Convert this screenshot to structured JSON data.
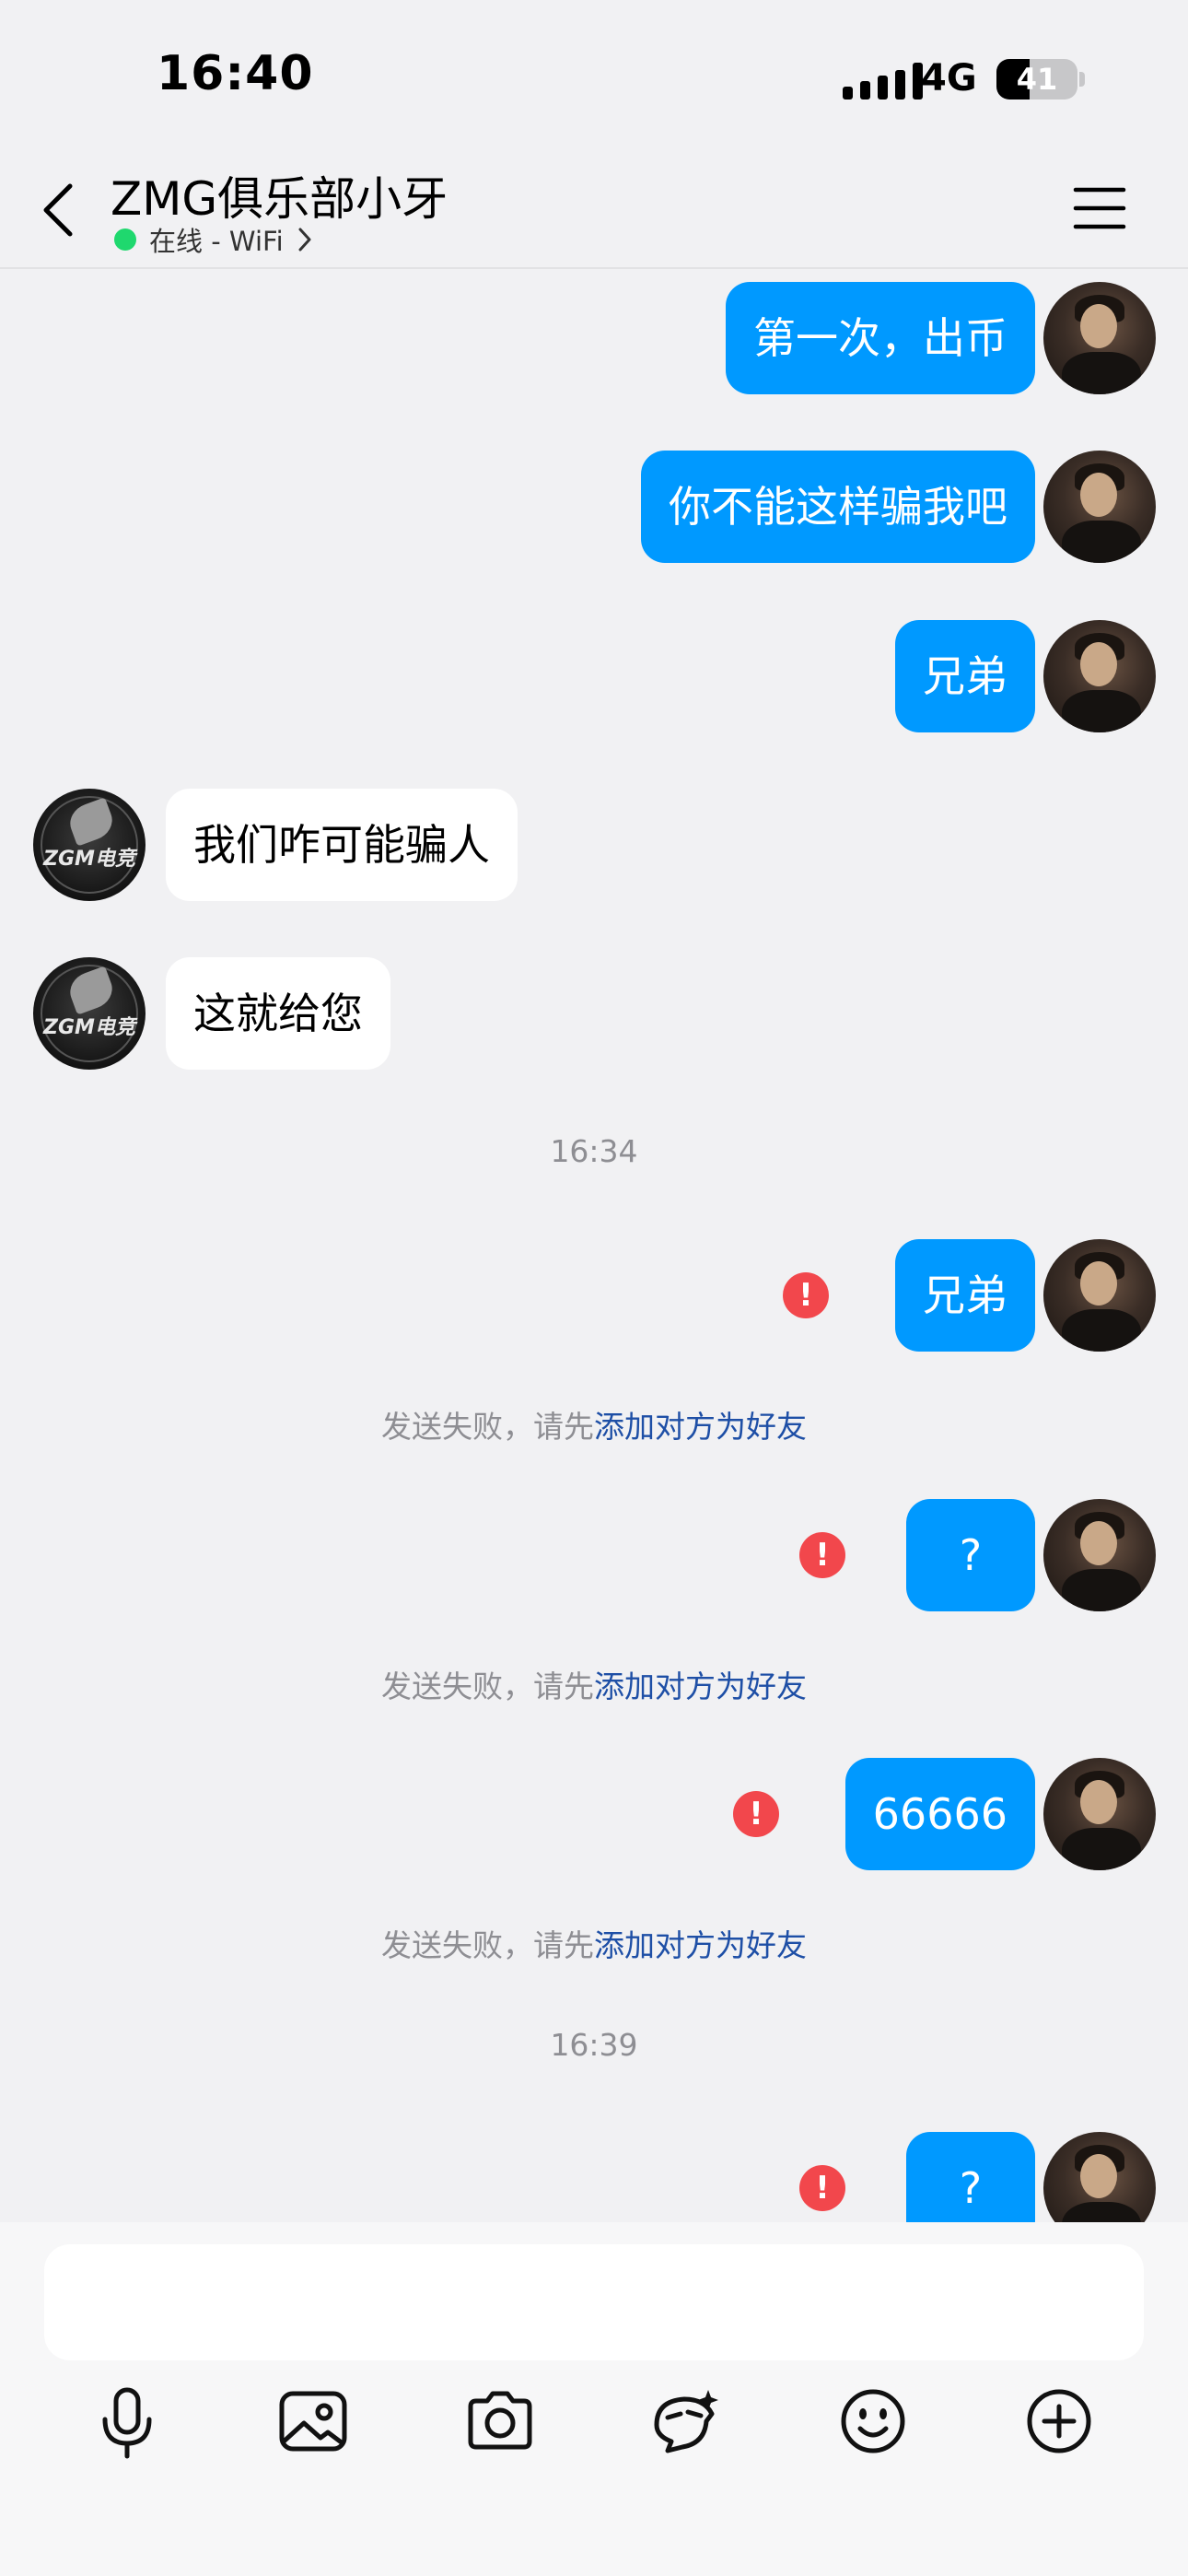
{
  "status_bar": {
    "time": "16:40",
    "network": "4G",
    "battery": "41",
    "battery_fraction": 0.41
  },
  "header": {
    "title": "ZMG俱乐部小牙",
    "status": "在线 - WiFi",
    "back_icon": "chevron-left-icon",
    "menu_icon": "hamburger-menu-icon"
  },
  "messages": {
    "m1": "第一次，出币",
    "m2": "你不能这样骗我吧",
    "m3": "兄弟",
    "m4": "我们咋可能骗人",
    "m5": "这就给您",
    "ts1": "16:34",
    "m6": "兄弟",
    "m7": "?",
    "m8": "66666",
    "ts2": "16:39",
    "m9": "?",
    "avatar_logo": "ZGM电竞"
  },
  "fail_note": {
    "prefix": "发送失败，请先",
    "link": "添加对方为好友"
  },
  "toolbar": {
    "icons": [
      "microphone-icon",
      "image-icon",
      "camera-icon",
      "sticker-icon",
      "emoji-icon",
      "plus-icon"
    ]
  },
  "colors": {
    "bubble_me": "#0099ff",
    "bubble_them": "#ffffff",
    "error": "#f2474c",
    "link": "#1e4fa6",
    "online": "#1fd86e",
    "background": "#f1f1f3"
  }
}
